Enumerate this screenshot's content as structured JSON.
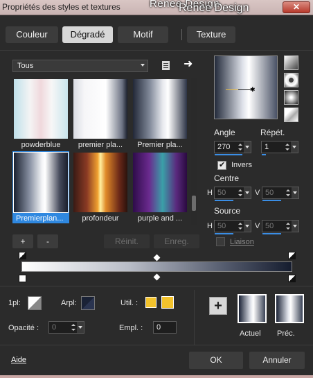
{
  "window": {
    "title": "Propriétés des styles et textures",
    "watermark_1": "Renee Design",
    "watermark_2": "Renee Design",
    "close_label": "✕"
  },
  "tabs": [
    {
      "label": "Couleur",
      "active": false
    },
    {
      "label": "Dégradé",
      "active": true
    },
    {
      "label": "Motif",
      "active": false
    },
    {
      "label": "Texture",
      "active": false
    }
  ],
  "filter": {
    "selected": "Tous"
  },
  "gradients": [
    {
      "label": "powderblue",
      "css": "linear-gradient(90deg,#bfe0ea 0%,#f4f4f4 30%,#f0d8dc 50%,#f7f7f7 70%,#c8e4ec 100%)"
    },
    {
      "label": "premier pla...",
      "css": "linear-gradient(90deg,#d9dbe2 0%,#f6f6f8 20%,#ffffff 60%,#6e7485 90%,#1a1f2c 100%)"
    },
    {
      "label": "Premier pla...",
      "css": "linear-gradient(90deg,#222838 0%,#7d8596 30%,#e7e9ee 55%,#ffffff 65%,#2d3446 100%)"
    },
    {
      "label": "Premierplan...",
      "css": "linear-gradient(90deg,#1a2130 0%,#8b93a5 30%,#f3f4f6 52%,#ffffff 58%,#44495a 85%,#1b1f2c 100%)"
    },
    {
      "label": "profondeur",
      "css": "linear-gradient(90deg,#3a1a14 0%,#8a3a24 25%,#f0a030 45%,#fff0a0 50%,#e08a28 60%,#6a2818 85%,#2a120c 100%)"
    },
    {
      "label": "purple and ...",
      "css": "linear-gradient(90deg,#2e0c4a 0%,#6a2a8e 30%,#3aa0a8 55%,#5a2a7e 80%,#2a0a40 100%)"
    }
  ],
  "gradient_buttons": {
    "add": "+",
    "remove": "-",
    "reset": "Réinit.",
    "save": "Enreg."
  },
  "angle": {
    "label": "Angle",
    "value": "270"
  },
  "repeat": {
    "label": "Répét.",
    "value": "1"
  },
  "invert": {
    "label": "Invers",
    "checked": true
  },
  "center": {
    "label": "Centre",
    "h_label": "H",
    "h_value": "50",
    "v_label": "V",
    "v_value": "50"
  },
  "source": {
    "label": "Source",
    "h_label": "H",
    "h_value": "50",
    "v_label": "V",
    "v_value": "50"
  },
  "link": {
    "label": "Liaison",
    "checked": false
  },
  "stop_controls": {
    "one_pl_label": "1pl:",
    "arpl_label": "Arpl:",
    "util_label": "Util. :",
    "opacity_label": "Opacité :",
    "opacity_value": "0",
    "empl_label": "Empl. :",
    "empl_value": "0",
    "util_color": "#f2c22c"
  },
  "swatches": {
    "current_label": "Actuel",
    "previous_label": "Préc."
  },
  "footer": {
    "help": "Aide",
    "ok": "OK",
    "cancel": "Annuler"
  }
}
